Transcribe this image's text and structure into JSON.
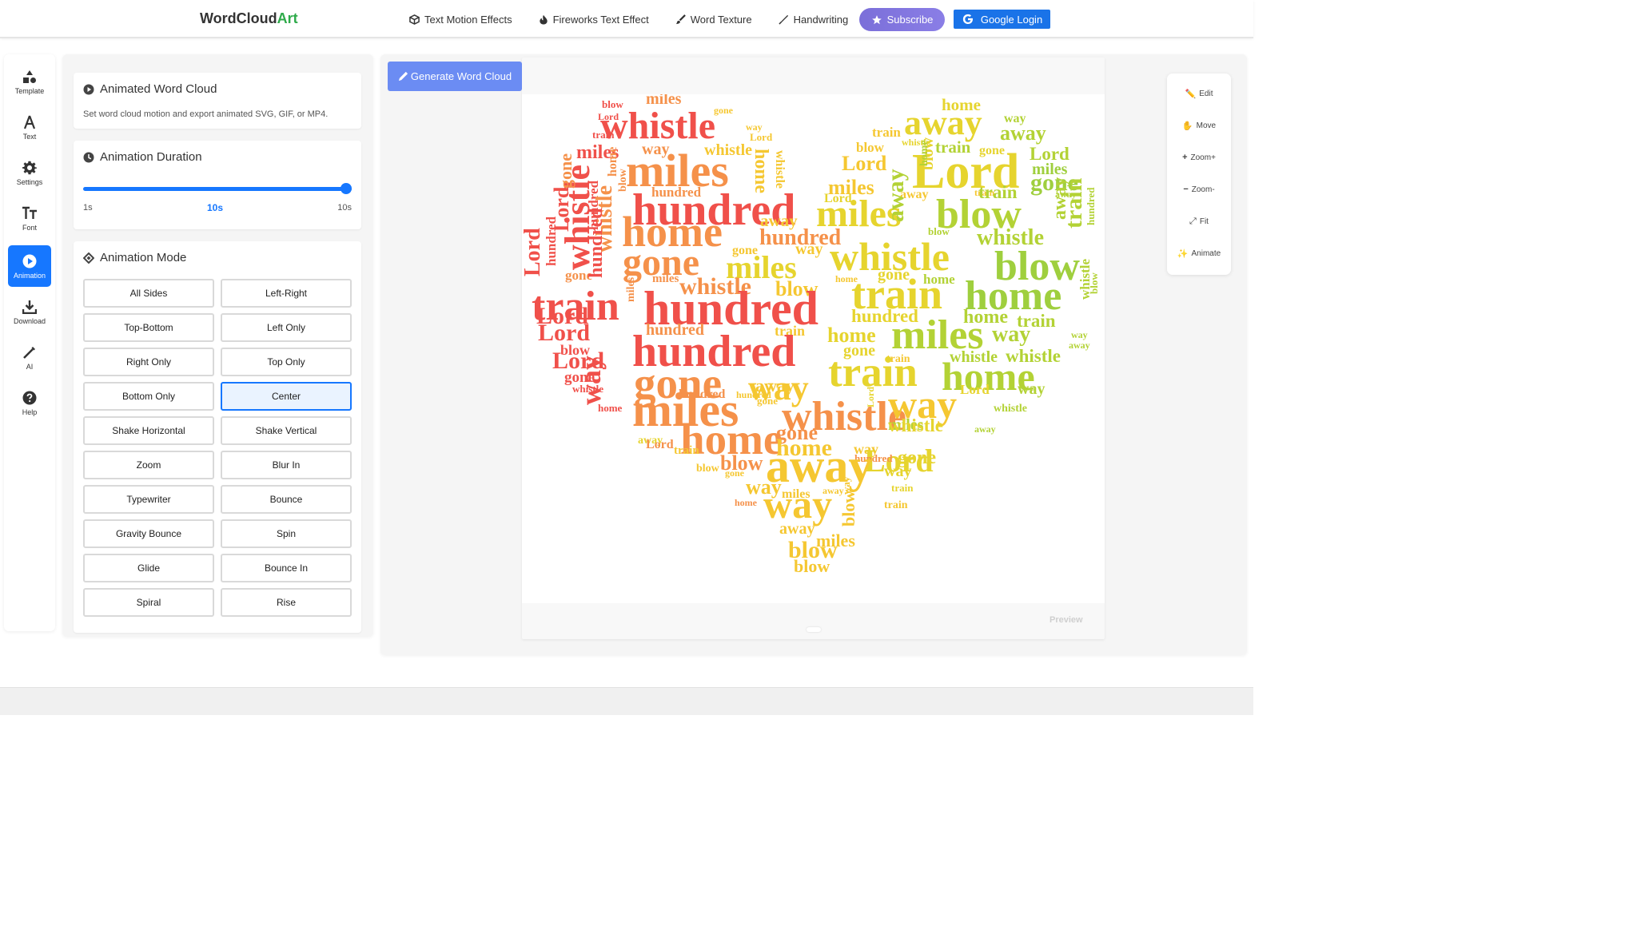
{
  "brand": {
    "prefix": "WordCloud",
    "suffix": "Art"
  },
  "nav": {
    "links": [
      {
        "label": "Text Motion Effects",
        "icon": "cube-icon"
      },
      {
        "label": "Fireworks Text Effect",
        "icon": "fire-icon"
      },
      {
        "label": "Word Texture",
        "icon": "brush-icon"
      },
      {
        "label": "Handwriting",
        "icon": "pen-icon"
      }
    ],
    "subscribe": "Subscribe",
    "google_login": "Google Login"
  },
  "rail": {
    "items": [
      {
        "label": "Template",
        "icon": "shapes-icon"
      },
      {
        "label": "Text",
        "icon": "letter-a-icon"
      },
      {
        "label": "Settings",
        "icon": "gear-icon"
      },
      {
        "label": "Font",
        "icon": "font-size-icon"
      },
      {
        "label": "Animation",
        "icon": "play-circle-icon",
        "active": true
      },
      {
        "label": "Download",
        "icon": "download-icon"
      },
      {
        "label": "AI",
        "icon": "magic-wand-icon"
      },
      {
        "label": "Help",
        "icon": "question-circle-icon"
      }
    ]
  },
  "panel": {
    "animated": {
      "title": "Animated Word Cloud",
      "description": "Set word cloud motion and export animated SVG, GIF, or MP4."
    },
    "duration": {
      "title": "Animation Duration",
      "min": "1s",
      "value": "10s",
      "max": "10s",
      "fraction": 1.0
    },
    "mode": {
      "title": "Animation Mode",
      "selected": "Center",
      "options": [
        "All Sides",
        "Left-Right",
        "Top-Bottom",
        "Left Only",
        "Right Only",
        "Top Only",
        "Bottom Only",
        "Center",
        "Shake Horizontal",
        "Shake Vertical",
        "Zoom",
        "Blur In",
        "Typewriter",
        "Bounce",
        "Gravity Bounce",
        "Spin",
        "Glide",
        "Bounce In",
        "Spiral",
        "Rise"
      ]
    }
  },
  "main": {
    "generate_label": "Generate Word Cloud",
    "preview_label": "Preview"
  },
  "tools": [
    {
      "label": "Edit",
      "icon": "pencil-icon"
    },
    {
      "label": "Move",
      "icon": "hand-icon"
    },
    {
      "label": "Zoom+",
      "icon": "plus-icon"
    },
    {
      "label": "Zoom-",
      "icon": "minus-icon"
    },
    {
      "label": "Fit",
      "icon": "expand-icon"
    },
    {
      "label": "Animate",
      "icon": "sparkle-icon"
    }
  ],
  "cloud": {
    "shape": "heart",
    "colors": {
      "red": "#f0504a",
      "orange": "#f5914a",
      "gold": "#f5c731",
      "yellow": "#e6d42e",
      "lime": "#b3d235",
      "green": "#9fcf3e"
    },
    "words": [
      {
        "t": "miles",
        "c": "orange"
      },
      {
        "t": "blow",
        "c": "red"
      },
      {
        "t": "gone",
        "c": "gold"
      },
      {
        "t": "Lord",
        "c": "red"
      },
      {
        "t": "whistle",
        "c": "red"
      },
      {
        "t": "way",
        "c": "gold"
      },
      {
        "t": "train",
        "c": "red"
      },
      {
        "t": "Lord",
        "c": "gold"
      },
      {
        "t": "miles",
        "c": "red"
      },
      {
        "t": "way",
        "c": "orange"
      },
      {
        "t": "whistle",
        "c": "gold"
      },
      {
        "t": "miles",
        "c": "orange"
      },
      {
        "t": "home",
        "c": "gold"
      },
      {
        "t": "whistle",
        "c": "gold"
      },
      {
        "t": "home",
        "c": "yellow"
      },
      {
        "t": "way",
        "c": "lime"
      },
      {
        "t": "away",
        "c": "yellow"
      },
      {
        "t": "away",
        "c": "lime"
      },
      {
        "t": "train",
        "c": "gold"
      },
      {
        "t": "whistle",
        "c": "yellow"
      },
      {
        "t": "blow",
        "c": "gold"
      },
      {
        "t": "train",
        "c": "lime"
      },
      {
        "t": "gone",
        "c": "yellow"
      },
      {
        "t": "Lord",
        "c": "gold"
      },
      {
        "t": "Lord",
        "c": "yellow"
      },
      {
        "t": "Lord",
        "c": "lime"
      },
      {
        "t": "miles",
        "c": "green"
      },
      {
        "t": "gone",
        "c": "green"
      },
      {
        "t": "miles",
        "c": "gold"
      },
      {
        "t": "hundred",
        "c": "orange"
      },
      {
        "t": "hundred",
        "c": "red"
      },
      {
        "t": "train",
        "c": "gold"
      },
      {
        "t": "Lord",
        "c": "yellow"
      },
      {
        "t": "away",
        "c": "gold"
      },
      {
        "t": "train",
        "c": "lime"
      },
      {
        "t": "away",
        "c": "lime"
      },
      {
        "t": "miles",
        "c": "yellow"
      },
      {
        "t": "blow",
        "c": "lime"
      },
      {
        "t": "home",
        "c": "orange"
      },
      {
        "t": "away",
        "c": "gold"
      },
      {
        "t": "hundred",
        "c": "orange"
      },
      {
        "t": "whistle",
        "c": "lime"
      },
      {
        "t": "blow",
        "c": "lime"
      },
      {
        "t": "gone",
        "c": "orange"
      },
      {
        "t": "gone",
        "c": "gold"
      },
      {
        "t": "miles",
        "c": "yellow"
      },
      {
        "t": "way",
        "c": "gold"
      },
      {
        "t": "whistle",
        "c": "yellow"
      },
      {
        "t": "blow",
        "c": "green"
      },
      {
        "t": "gone",
        "c": "orange"
      },
      {
        "t": "miles",
        "c": "orange"
      },
      {
        "t": "whistle",
        "c": "orange"
      },
      {
        "t": "blow",
        "c": "gold"
      },
      {
        "t": "home",
        "c": "gold"
      },
      {
        "t": "gone",
        "c": "yellow"
      },
      {
        "t": "home",
        "c": "lime"
      },
      {
        "t": "train",
        "c": "red"
      },
      {
        "t": "hundred",
        "c": "red"
      },
      {
        "t": "train",
        "c": "yellow"
      },
      {
        "t": "home",
        "c": "green"
      },
      {
        "t": "Lord",
        "c": "red"
      },
      {
        "t": "hundred",
        "c": "yellow"
      },
      {
        "t": "home",
        "c": "lime"
      },
      {
        "t": "train",
        "c": "lime"
      },
      {
        "t": "Lord",
        "c": "red"
      },
      {
        "t": "hundred",
        "c": "orange"
      },
      {
        "t": "train",
        "c": "gold"
      },
      {
        "t": "home",
        "c": "yellow"
      },
      {
        "t": "miles",
        "c": "lime"
      },
      {
        "t": "way",
        "c": "lime"
      },
      {
        "t": "way",
        "c": "lime"
      },
      {
        "t": "away",
        "c": "lime"
      },
      {
        "t": "hundred",
        "c": "red"
      },
      {
        "t": "gone",
        "c": "yellow"
      },
      {
        "t": "blow",
        "c": "red"
      },
      {
        "t": "train",
        "c": "gold"
      },
      {
        "t": "whistle",
        "c": "lime"
      },
      {
        "t": "whistle",
        "c": "lime"
      },
      {
        "t": "Lord",
        "c": "red"
      },
      {
        "t": "gone",
        "c": "orange"
      },
      {
        "t": "way",
        "c": "gold"
      },
      {
        "t": "train",
        "c": "yellow"
      },
      {
        "t": "home",
        "c": "lime"
      },
      {
        "t": "gone",
        "c": "red"
      },
      {
        "t": "away",
        "c": "gold"
      },
      {
        "t": "Lord",
        "c": "yellow"
      },
      {
        "t": "way",
        "c": "lime"
      },
      {
        "t": "whistle",
        "c": "red"
      },
      {
        "t": "hundred",
        "c": "orange"
      },
      {
        "t": "hundred",
        "c": "gold"
      },
      {
        "t": "gone",
        "c": "gold"
      },
      {
        "t": "home",
        "c": "red"
      },
      {
        "t": "miles",
        "c": "orange"
      },
      {
        "t": "whistle",
        "c": "orange"
      },
      {
        "t": "way",
        "c": "gold"
      },
      {
        "t": "away",
        "c": "yellow"
      },
      {
        "t": "miles",
        "c": "lime"
      },
      {
        "t": "whistle",
        "c": "lime"
      },
      {
        "t": "whistle",
        "c": "yellow"
      },
      {
        "t": "away",
        "c": "lime"
      },
      {
        "t": "home",
        "c": "orange"
      },
      {
        "t": "Lord",
        "c": "orange"
      },
      {
        "t": "gone",
        "c": "orange"
      },
      {
        "t": "train",
        "c": "gold"
      },
      {
        "t": "way",
        "c": "gold"
      },
      {
        "t": "home",
        "c": "gold"
      },
      {
        "t": "Lord",
        "c": "yellow"
      },
      {
        "t": "hundred",
        "c": "orange"
      },
      {
        "t": "gone",
        "c": "yellow"
      },
      {
        "t": "blow",
        "c": "orange"
      },
      {
        "t": "blow",
        "c": "gold"
      },
      {
        "t": "gone",
        "c": "gold"
      },
      {
        "t": "away",
        "c": "gold"
      },
      {
        "t": "way",
        "c": "yellow"
      },
      {
        "t": "way",
        "c": "gold"
      },
      {
        "t": "miles",
        "c": "gold"
      },
      {
        "t": "away",
        "c": "gold"
      },
      {
        "t": "train",
        "c": "yellow"
      },
      {
        "t": "home",
        "c": "orange"
      },
      {
        "t": "way",
        "c": "gold"
      },
      {
        "t": "away",
        "c": "gold"
      },
      {
        "t": "miles",
        "c": "gold"
      },
      {
        "t": "blow",
        "c": "gold"
      },
      {
        "t": "blow",
        "c": "gold"
      },
      {
        "t": "train",
        "c": "gold"
      },
      {
        "t": "Lord",
        "c": "red"
      },
      {
        "t": "hundred",
        "c": "red"
      },
      {
        "t": "whistle",
        "c": "red"
      },
      {
        "t": "Lord",
        "c": "red"
      },
      {
        "t": "hundred",
        "c": "red"
      },
      {
        "t": "gone",
        "c": "orange"
      },
      {
        "t": "whistle",
        "c": "orange"
      },
      {
        "t": "home",
        "c": "orange"
      },
      {
        "t": "way",
        "c": "red"
      },
      {
        "t": "hundred",
        "c": "red"
      },
      {
        "t": "miles",
        "c": "orange"
      },
      {
        "t": "blow",
        "c": "orange"
      },
      {
        "t": "away",
        "c": "lime"
      },
      {
        "t": "blow",
        "c": "yellow"
      },
      {
        "t": "home",
        "c": "lime"
      },
      {
        "t": "away",
        "c": "lime"
      },
      {
        "t": "train",
        "c": "lime"
      },
      {
        "t": "hundred",
        "c": "lime"
      },
      {
        "t": "blow",
        "c": "lime"
      },
      {
        "t": "whistle",
        "c": "lime"
      },
      {
        "t": "Lord",
        "c": "yellow"
      },
      {
        "t": "way",
        "c": "gold"
      },
      {
        "t": "blow",
        "c": "gold"
      }
    ]
  }
}
